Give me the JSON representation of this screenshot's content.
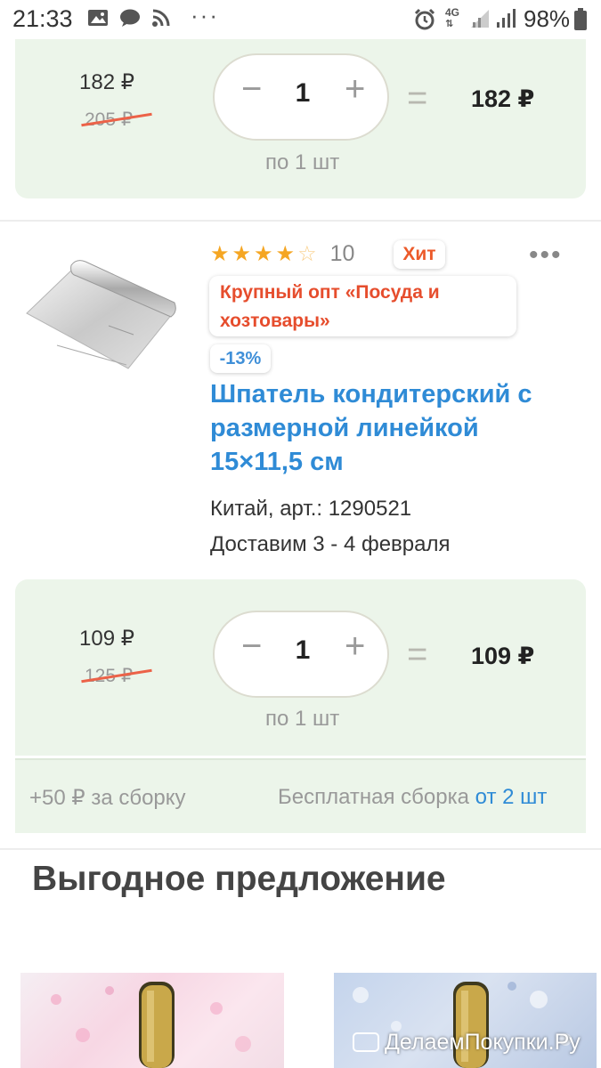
{
  "status_bar": {
    "time": "21:33",
    "battery": "98%",
    "network": "4G"
  },
  "price_block_1": {
    "unit_price": "182 ₽",
    "old_price": "205 ₽",
    "quantity": "1",
    "minus": "−",
    "plus": "+",
    "equals": "=",
    "total": "182 ₽",
    "per_unit": "по 1 шт"
  },
  "product": {
    "rating": 4,
    "rating_count": "10",
    "badge": "Хит",
    "more": "•••",
    "promo": "Крупный опт «Посуда и хозтовары»",
    "discount": "-13%",
    "title": "Шпатель кондитерский с размерной линейкой 15×11,5 см",
    "origin": "Китай, арт.: 1290521",
    "delivery": "Доставим 3 - 4 февраля"
  },
  "price_block_2": {
    "unit_price": "109 ₽",
    "old_price": "125 ₽",
    "quantity": "1",
    "minus": "−",
    "plus": "+",
    "equals": "=",
    "total": "109 ₽",
    "per_unit": "по 1 шт"
  },
  "assembly": {
    "left": "+50 ₽ за сборку",
    "right_prefix": "Бесплатная сборка ",
    "right_link": "от 2 шт"
  },
  "section": {
    "title": "Выгодное предложение"
  },
  "watermark": "ДелаемПокупки.Ру",
  "colors": {
    "price_bg": "#ecf5ea",
    "link": "#2f8bd6",
    "promo": "#e64d2d",
    "star": "#f5a623"
  }
}
